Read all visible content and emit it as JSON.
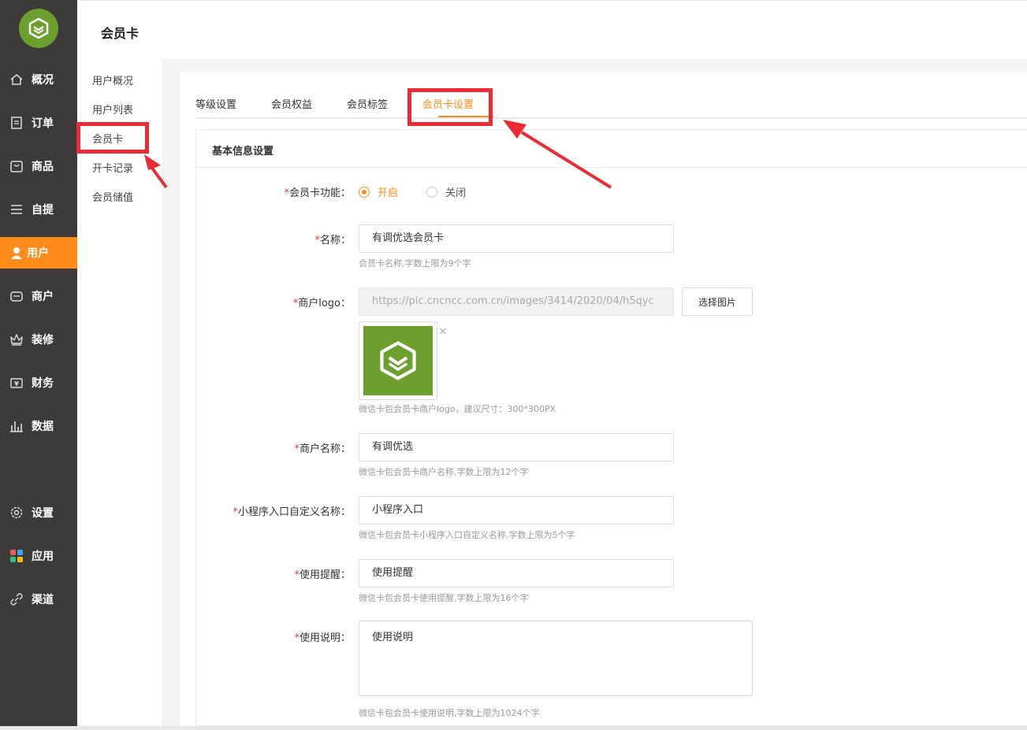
{
  "header": {
    "title": "会员卡"
  },
  "sidebar": {
    "items": [
      {
        "label": "概况",
        "icon": "home-icon"
      },
      {
        "label": "订单",
        "icon": "order-icon"
      },
      {
        "label": "商品",
        "icon": "bag-icon"
      },
      {
        "label": "自提",
        "icon": "list-icon"
      },
      {
        "label": "用户",
        "icon": "user-icon"
      },
      {
        "label": "商户",
        "icon": "store-icon"
      },
      {
        "label": "装修",
        "icon": "crown-icon"
      },
      {
        "label": "财务",
        "icon": "wallet-icon"
      },
      {
        "label": "数据",
        "icon": "bar-chart-icon"
      },
      {
        "label": "设置",
        "icon": "gear-icon"
      },
      {
        "label": "应用",
        "icon": "apps-icon"
      },
      {
        "label": "渠道",
        "icon": "link-icon"
      }
    ],
    "active": "用户"
  },
  "subnav": {
    "items": [
      "用户概况",
      "用户列表",
      "会员卡",
      "开卡记录",
      "会员储值"
    ],
    "active": "会员卡"
  },
  "tabs": {
    "items": [
      "等级设置",
      "会员权益",
      "会员标签",
      "会员卡设置"
    ],
    "active": "会员卡设置"
  },
  "section": {
    "title": "基本信息设置"
  },
  "form": {
    "required_mark": "*",
    "card_function": {
      "label": "会员卡功能：",
      "options": [
        "开启",
        "关闭"
      ],
      "selected": "开启"
    },
    "name": {
      "label": "名称：",
      "value": "有调优选会员卡",
      "hint": "会员卡名称,字数上限为9个字"
    },
    "merchant_logo": {
      "label": "商户logo：",
      "value": "https://pic.cncncc.com.cn/images/3414/2020/04/h5qyc",
      "button": "选择图片",
      "remove": "×",
      "hint": "微信卡包会员卡商户logo，建议尺寸：300*300PX"
    },
    "merchant_name": {
      "label": "商户名称：",
      "value": "有调优选",
      "hint": "微信卡包会员卡商户名称,字数上限为12个字"
    },
    "mini_entry_name": {
      "label": "小程序入口自定义名称：",
      "value": "小程序入口",
      "hint": "微信卡包会员卡小程序入口自定义名称,字数上限为5个字"
    },
    "usage_reminder": {
      "label": "使用提醒：",
      "value": "使用提醒",
      "hint": "微信卡包会员卡使用提醒,字数上限为16个字"
    },
    "usage_description": {
      "label": "使用说明：",
      "value": "使用说明",
      "hint": "微信卡包会员卡使用说明,字数上限为1024个字"
    }
  },
  "colors": {
    "accent": "#ff8c1a",
    "sidebar_bg": "#3c3b39",
    "brand_green": "#6c9f2e",
    "highlight_red": "#ec2a33",
    "required_red": "#e4393c"
  }
}
